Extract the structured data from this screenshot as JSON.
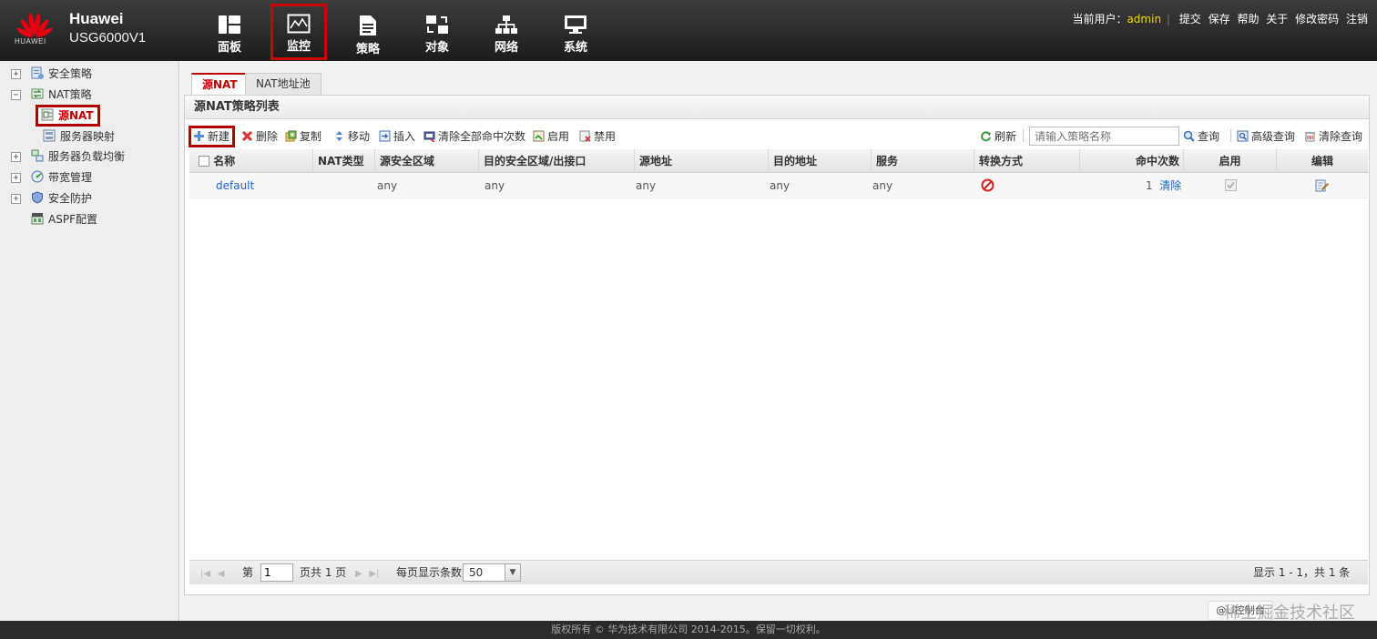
{
  "header": {
    "logo_text": "HUAWEI",
    "brand_line1": "Huawei",
    "brand_line2": "USG6000V1",
    "nav": [
      {
        "label": "面板",
        "icon": "dashboard-icon"
      },
      {
        "label": "监控",
        "icon": "monitor-chart-icon",
        "active": true
      },
      {
        "label": "策略",
        "icon": "policy-document-icon"
      },
      {
        "label": "对象",
        "icon": "object-icon"
      },
      {
        "label": "网络",
        "icon": "network-icon"
      },
      {
        "label": "系统",
        "icon": "system-computer-icon"
      }
    ],
    "user_prefix": "当前用户：",
    "user_name": "admin",
    "links": [
      "提交",
      "保存",
      "帮助",
      "关于",
      "修改密码",
      "注销"
    ]
  },
  "sidebar": {
    "items": [
      {
        "label": "安全策略",
        "icon": "security-policy-icon"
      },
      {
        "label": "NAT策略",
        "icon": "nat-policy-icon"
      },
      {
        "label": "源NAT",
        "icon": "source-nat-icon"
      },
      {
        "label": "服务器映射",
        "icon": "server-mapping-icon"
      },
      {
        "label": "服务器负载均衡",
        "icon": "load-balance-icon"
      },
      {
        "label": "带宽管理",
        "icon": "bandwidth-icon"
      },
      {
        "label": "安全防护",
        "icon": "shield-icon"
      },
      {
        "label": "ASPF配置",
        "icon": "aspf-icon"
      }
    ]
  },
  "tabs": [
    "源NAT",
    "NAT地址池"
  ],
  "panel": {
    "title": "源NAT策略列表",
    "toolbar": {
      "new": "新建",
      "delete": "删除",
      "copy": "复制",
      "move": "移动",
      "insert": "插入",
      "clear_hits": "清除全部命中次数",
      "enable": "启用",
      "disable": "禁用",
      "refresh": "刷新",
      "search_placeholder": "请输入策略名称",
      "query": "查询",
      "advanced_query": "高级查询",
      "clear_query": "清除查询"
    },
    "columns": [
      "名称",
      "NAT类型",
      "源安全区域",
      "目的安全区域/出接口",
      "源地址",
      "目的地址",
      "服务",
      "转换方式",
      "命中次数",
      "启用",
      "编辑"
    ],
    "rows": [
      {
        "name": "default",
        "nat_type": "",
        "src_zone": "any",
        "dst_zone": "any",
        "src_addr": "any",
        "dst_addr": "any",
        "service": "any",
        "hits": "1",
        "clear_label": "清除"
      }
    ],
    "pager": {
      "page_prefix": "第",
      "page_value": "1",
      "page_suffix": "页共 1 页",
      "per_page_label": "每页显示条数",
      "per_page_value": "50",
      "summary": "显示 1 - 1，共 1 条"
    }
  },
  "watermark": {
    "badge": "@Li控制台",
    "text": "稀土掘金技术社区"
  },
  "footer": "版权所有 © 华为技术有限公司 2014-2015。保留一切权利。",
  "colors": {
    "accent_red": "#c00000",
    "link_blue": "#1a66c9",
    "user_yellow": "#f5d800"
  }
}
